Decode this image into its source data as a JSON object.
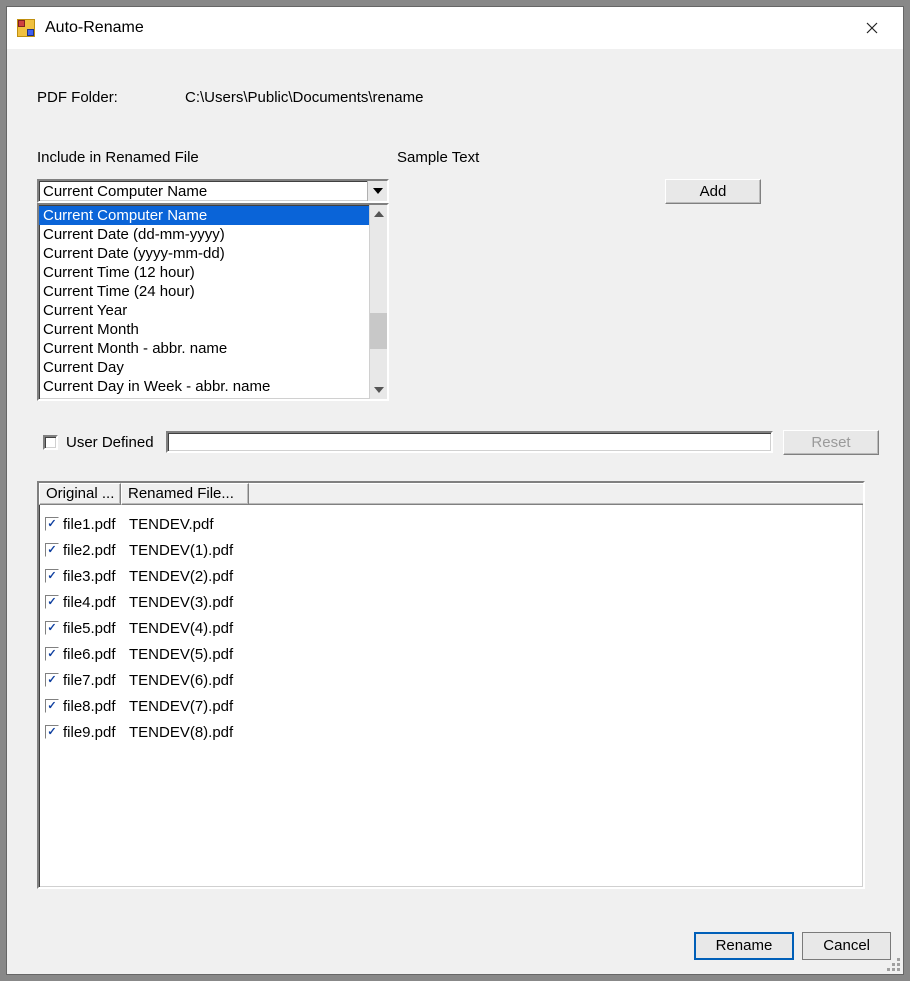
{
  "window": {
    "title": "Auto-Rename"
  },
  "folder": {
    "label": "PDF Folder:",
    "path": "C:\\Users\\Public\\Documents\\rename"
  },
  "section": {
    "include_label": "Include in Renamed File",
    "sample_label": "Sample Text",
    "add_button": "Add"
  },
  "combo": {
    "selected": "Current Computer Name",
    "options": [
      "Current Computer Name",
      "Current Date (dd-mm-yyyy)",
      "Current Date (yyyy-mm-dd)",
      "Current Time (12 hour)",
      "Current Time (24 hour)",
      "Current Year",
      "Current Month",
      "Current Month - abbr. name",
      "Current Day",
      "Current Day in Week - abbr. name"
    ]
  },
  "userdef": {
    "label": "User Defined",
    "reset_button": "Reset"
  },
  "filelist": {
    "col_original": "Original ...",
    "col_renamed": "Renamed File...",
    "rows": [
      {
        "checked": true,
        "original": "file1.pdf",
        "renamed": "TENDEV.pdf"
      },
      {
        "checked": true,
        "original": "file2.pdf",
        "renamed": "TENDEV(1).pdf"
      },
      {
        "checked": true,
        "original": "file3.pdf",
        "renamed": "TENDEV(2).pdf"
      },
      {
        "checked": true,
        "original": "file4.pdf",
        "renamed": "TENDEV(3).pdf"
      },
      {
        "checked": true,
        "original": "file5.pdf",
        "renamed": "TENDEV(4).pdf"
      },
      {
        "checked": true,
        "original": "file6.pdf",
        "renamed": "TENDEV(5).pdf"
      },
      {
        "checked": true,
        "original": "file7.pdf",
        "renamed": "TENDEV(6).pdf"
      },
      {
        "checked": true,
        "original": "file8.pdf",
        "renamed": "TENDEV(7).pdf"
      },
      {
        "checked": true,
        "original": "file9.pdf",
        "renamed": "TENDEV(8).pdf"
      }
    ]
  },
  "footer": {
    "rename_button": "Rename",
    "cancel_button": "Cancel"
  }
}
